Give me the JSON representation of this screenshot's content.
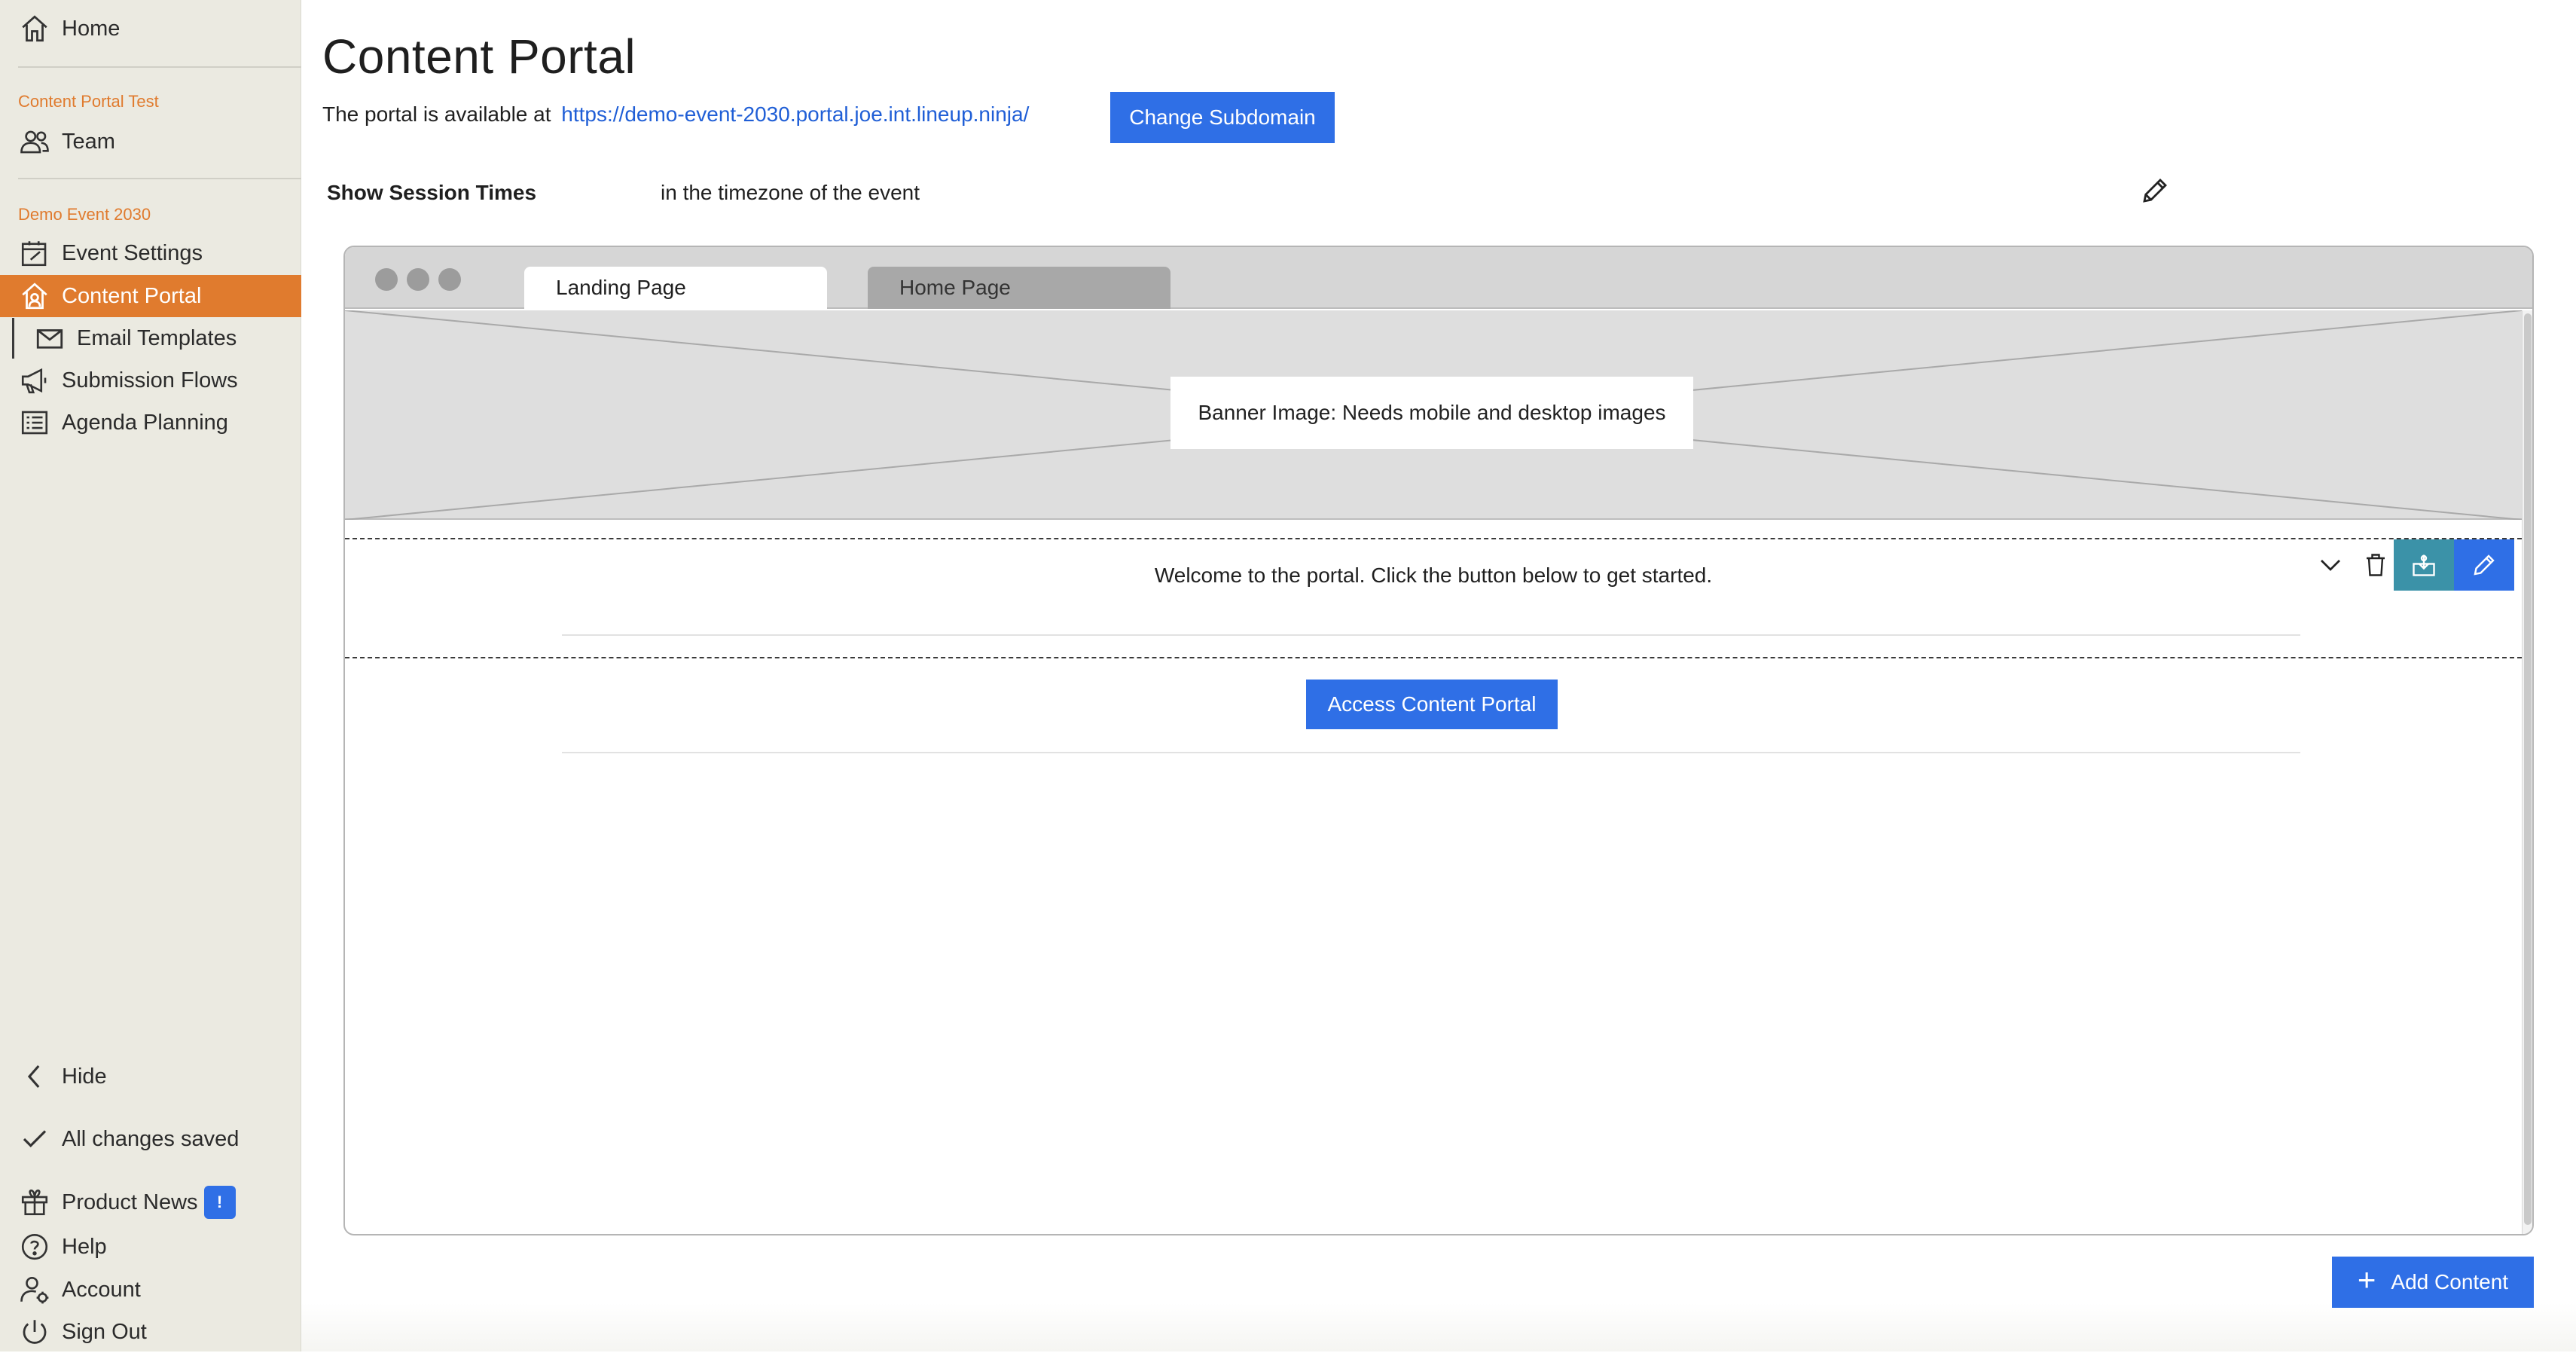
{
  "sidebar": {
    "home": "Home",
    "org_label": "Content Portal Test",
    "team": "Team",
    "event_label": "Demo Event 2030",
    "items": [
      {
        "label": "Event Settings"
      },
      {
        "label": "Content Portal"
      },
      {
        "label": "Email Templates"
      },
      {
        "label": "Submission Flows"
      },
      {
        "label": "Agenda Planning"
      }
    ],
    "hide": "Hide",
    "saved_status": "All changes saved",
    "product_news": "Product News",
    "product_news_badge": "!",
    "help": "Help",
    "account": "Account",
    "sign_out": "Sign Out"
  },
  "main": {
    "title": "Content Portal",
    "portal_prefix": "The portal is available at",
    "portal_url": "https://demo-event-2030.portal.joe.int.lineup.ninja/",
    "change_subdomain": "Change Subdomain",
    "session_label": "Show Session Times",
    "session_value": "in the timezone of the event",
    "tabs": [
      {
        "label": "Landing Page",
        "active": true
      },
      {
        "label": "Home Page",
        "active": false
      }
    ],
    "banner_label": "Banner Image: Needs mobile and desktop images",
    "welcome_text": "Welcome to the portal. Click the button below to get started.",
    "access_button": "Access Content Portal",
    "add_content": "Add Content"
  },
  "colors": {
    "accent_orange": "#e07b2e",
    "primary_blue": "#2f6fe6",
    "teal": "#3b92a8",
    "sidebar_bg": "#ebeae1"
  },
  "icons": [
    "home-icon",
    "team-icon",
    "calendar-edit-icon",
    "house-portal-icon",
    "envelope-icon",
    "megaphone-icon",
    "list-icon",
    "chevron-left-icon",
    "check-icon",
    "gift-icon",
    "help-circle-icon",
    "account-gear-icon",
    "power-icon",
    "pencil-icon",
    "chevron-down-icon",
    "trash-icon",
    "save-block-icon",
    "plus-icon"
  ]
}
